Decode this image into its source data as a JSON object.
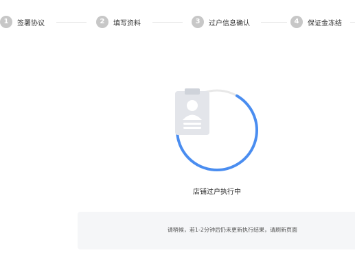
{
  "steps": [
    {
      "number": "1",
      "label": "签署协议"
    },
    {
      "number": "2",
      "label": "填写资料"
    },
    {
      "number": "3",
      "label": "过户信息确认"
    },
    {
      "number": "4",
      "label": "保证金冻结"
    }
  ],
  "status": {
    "label": "店铺过户执行中",
    "progress_fraction": 0.75,
    "icon": "clipboard-user-icon"
  },
  "notice": {
    "text": "请稍候，若1-2分钟后仍未更新执行结果，请刷新页面"
  },
  "colors": {
    "accent": "#4a8df0",
    "track": "#e8e8e8",
    "step_inactive": "#c7c7c7",
    "notice_bg": "#f5f6f8"
  }
}
